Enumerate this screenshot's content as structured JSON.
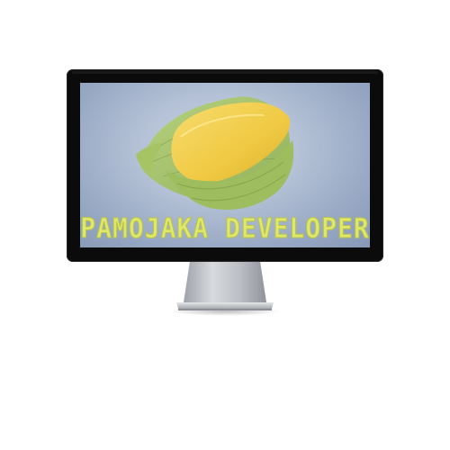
{
  "brand": {
    "text": "PAMOJAKA DEVELOPER"
  },
  "colors": {
    "bezel": "#0b0b0b",
    "screen_light": "#c9d3e3",
    "screen_dark": "#8698b6",
    "leaf_green": "#a9c66a",
    "leaf_dark": "#86a64e",
    "cake_yellow": "#f2cf52",
    "text_yellow": "#dfe86a",
    "stand_silver": "#c9ccd2"
  }
}
